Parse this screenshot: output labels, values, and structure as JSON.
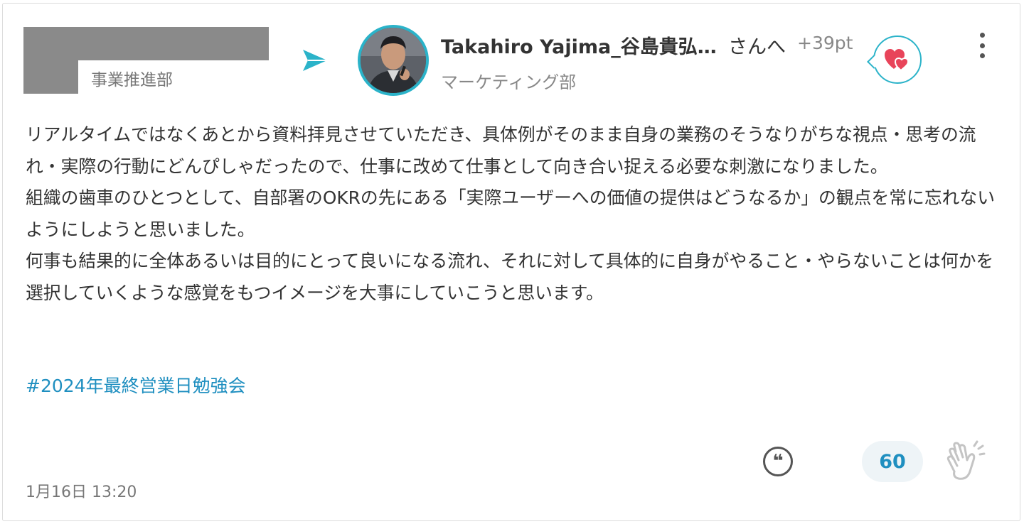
{
  "sender": {
    "department": "事業推進部"
  },
  "receiver": {
    "name": "Takahiro Yajima_谷島貴弘…",
    "suffix": "さんへ",
    "points": "+39pt",
    "department": "マーケティング部"
  },
  "post": {
    "body": "リアルタイムではなくあとから資料拝見させていただき、具体例がそのまま自身の業務のそうなりがちな視点・思考の流れ・実際の行動にどんぴしゃだったので、仕事に改めて仕事として向き合い捉える必要な刺激になりました。\n組織の歯車のひとつとして、自部署のOKRの先にある「実際ユーザーへの価値の提供はどうなるか」の観点を常に忘れないようにしようと思いました。\n何事も結果的に全体あるいは目的にとって良いになる流れ、それに対して具体的に自身がやること・やらないことは何かを選択していくような感覚をもつイメージを大事にしていこうと思います。",
    "hashtag": "#2024年最終営業日勉強会",
    "timestamp": "1月16日 13:20"
  },
  "actions": {
    "quote_glyph": "❝",
    "clap_count": "60"
  },
  "colors": {
    "accent": "#2bb3c9",
    "link": "#1f8fc0",
    "heart": "#e8445a"
  },
  "icons": [
    "send-arrow-icon",
    "heart-icon",
    "more-vertical-icon",
    "quote-icon",
    "clap-icon"
  ]
}
